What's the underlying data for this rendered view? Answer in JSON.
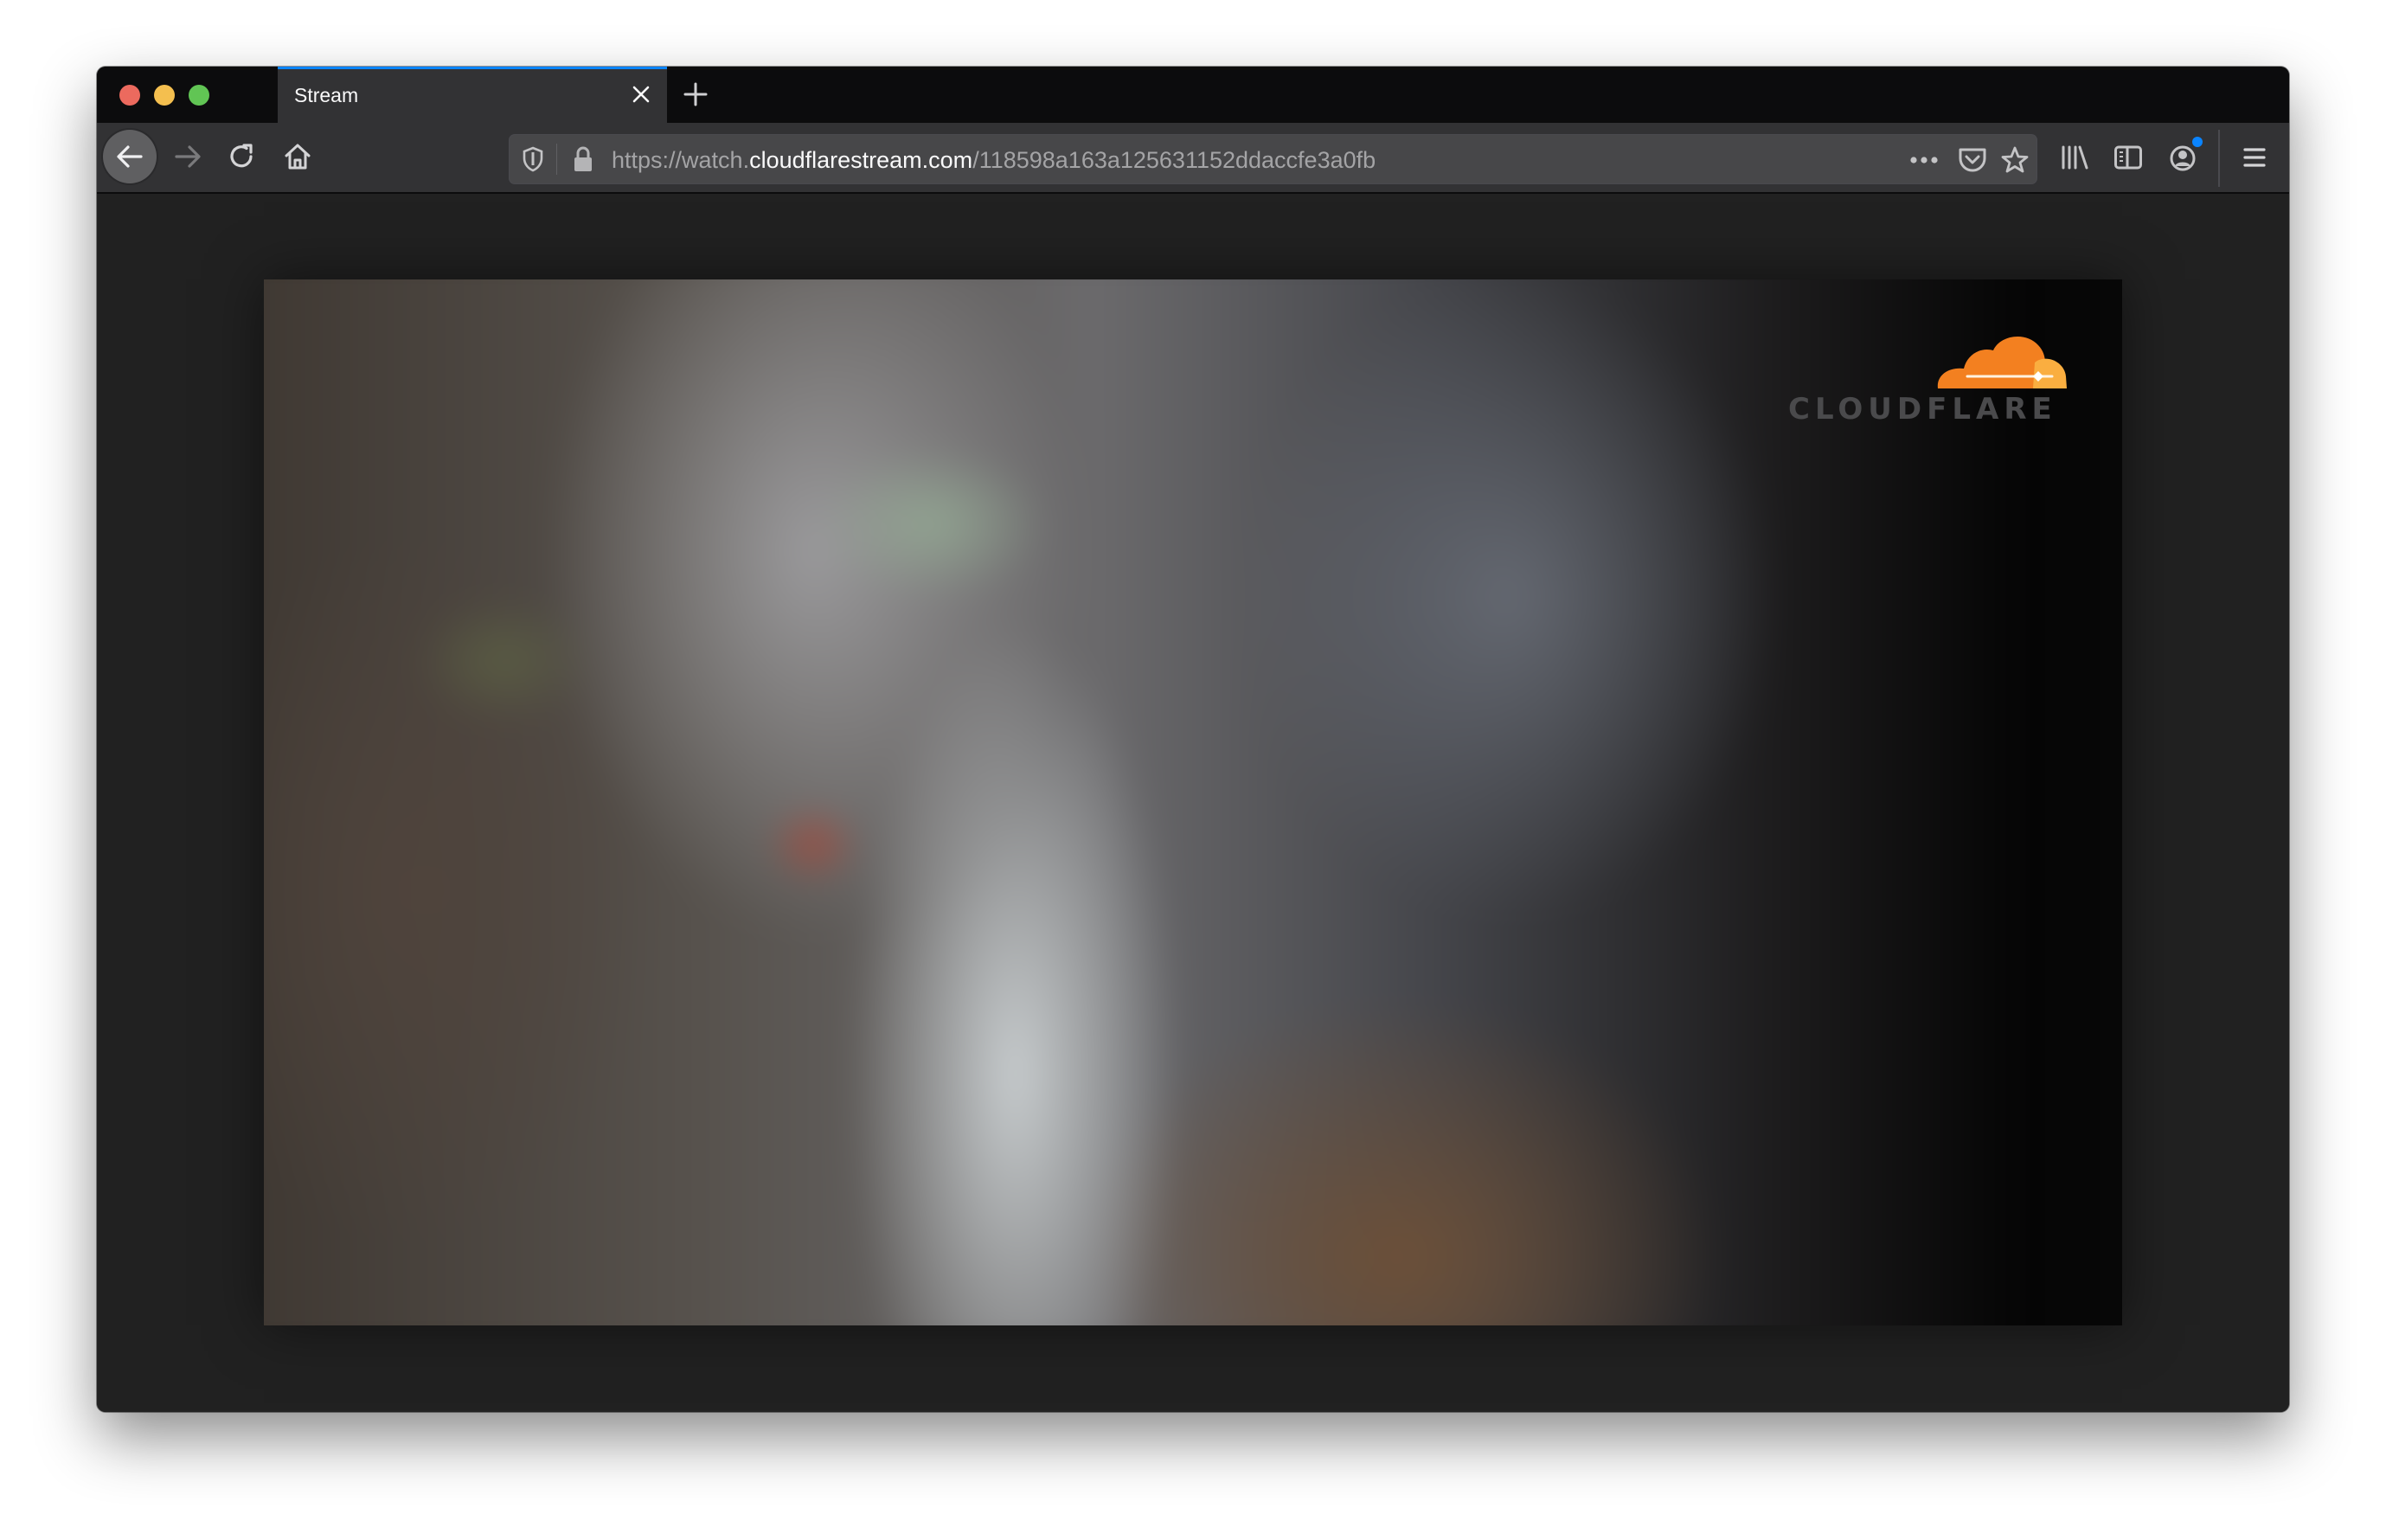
{
  "browser": {
    "tab": {
      "title": "Stream",
      "close_icon": "close-icon"
    },
    "new_tab_icon": "plus-icon",
    "toolbar": {
      "back_icon": "arrow-left-icon",
      "forward_icon": "arrow-right-icon",
      "reload_icon": "reload-icon",
      "home_icon": "home-icon"
    },
    "urlbar": {
      "scheme_prefix": "https://watch.",
      "host": "cloudflarestream.com",
      "path": "/118598a163a125631152ddaccfe3a0fb",
      "full_url": "https://watch.cloudflarestream.com/118598a163a125631152ddaccfe3a0fb",
      "tracking_icon": "shield-icon",
      "lock_icon": "lock-icon",
      "page_actions_icon": "more-horizontal-icon",
      "pocket_icon": "pocket-icon",
      "bookmark_icon": "star-icon"
    },
    "right_toolbar": {
      "library_icon": "library-icon",
      "sidebar_icon": "sidebar-icon",
      "account_icon": "account-icon",
      "menu_icon": "hamburger-menu-icon"
    }
  },
  "video": {
    "description": "blurred close-up of a grey tabby cat",
    "watermark_text": "CLOUDFLARE",
    "brand_colors": {
      "cloud_orange": "#f38020",
      "cloud_light": "#faae40",
      "text_grey": "#4a4a4c"
    }
  },
  "colors": {
    "tab_accent": "#0a84ff",
    "toolbar_bg": "#323234",
    "tabbar_bg": "#0c0c0d",
    "content_bg": "#212121"
  }
}
